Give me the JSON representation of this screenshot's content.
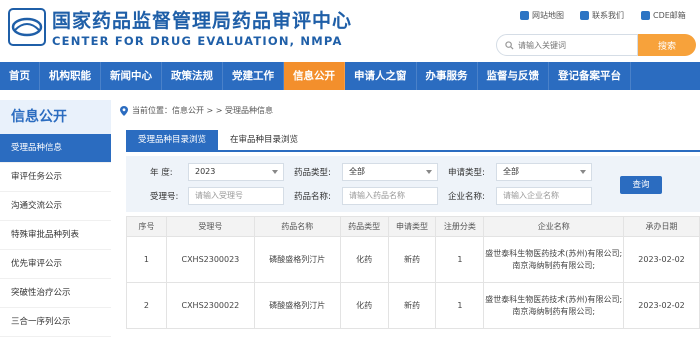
{
  "header": {
    "title_cn": "国家药品监督管理局药品审评中心",
    "title_en": "CENTER FOR DRUG EVALUATION, NMPA",
    "links": [
      "网站地图",
      "联系我们",
      "CDE邮箱"
    ],
    "search_placeholder": "请输入关键词",
    "search_button": "搜索"
  },
  "nav": {
    "items": [
      "首页",
      "机构职能",
      "新闻中心",
      "政策法规",
      "党建工作",
      "信息公开",
      "申请人之窗",
      "办事服务",
      "监督与反馈",
      "登记备案平台"
    ],
    "active": "信息公开"
  },
  "sidebar": {
    "title": "信息公开",
    "items": [
      "受理品种信息",
      "审评任务公示",
      "沟通交流公示",
      "特殊审批品种列表",
      "优先审评公示",
      "突破性治疗公示",
      "三合一序列公示"
    ]
  },
  "breadcrumb": {
    "prefix": "当前位置：信息公开 > > 受理品种信息"
  },
  "tabs": [
    "受理品种目录浏览",
    "在审品种目录浏览"
  ],
  "filters": {
    "year_label": "年    度:",
    "year_value": "2023",
    "drug_type_label": "药品类型:",
    "drug_type_value": "全部",
    "apply_type_label": "申请类型:",
    "apply_type_value": "全部",
    "acceptance_label": "受理号:",
    "acceptance_placeholder": "请输入受理号",
    "drug_name_label": "药品名称:",
    "drug_name_placeholder": "请输入药品名称",
    "company_label": "企业名称:",
    "company_placeholder": "请输入企业名称",
    "query_button": "查询"
  },
  "table": {
    "headers": [
      "序号",
      "受理号",
      "药品名称",
      "药品类型",
      "申请类型",
      "注册分类",
      "企业名称",
      "承办日期"
    ],
    "rows": [
      [
        "1",
        "CXHS2300023",
        "磷酸盛格列汀片",
        "化药",
        "新药",
        "1",
        "盛世泰科生物医药技术(苏州)有限公司;南京海纳制药有限公司;",
        "2023-02-02"
      ],
      [
        "2",
        "CXHS2300022",
        "磷酸盛格列汀片",
        "化药",
        "新药",
        "1",
        "盛世泰科生物医药技术(苏州)有限公司;南京海纳制药有限公司;",
        "2023-02-02"
      ]
    ]
  },
  "colors": {
    "brand_blue": "#2b6cc0",
    "active_orange": "#f38f2c",
    "search_orange": "#f7a23b"
  }
}
